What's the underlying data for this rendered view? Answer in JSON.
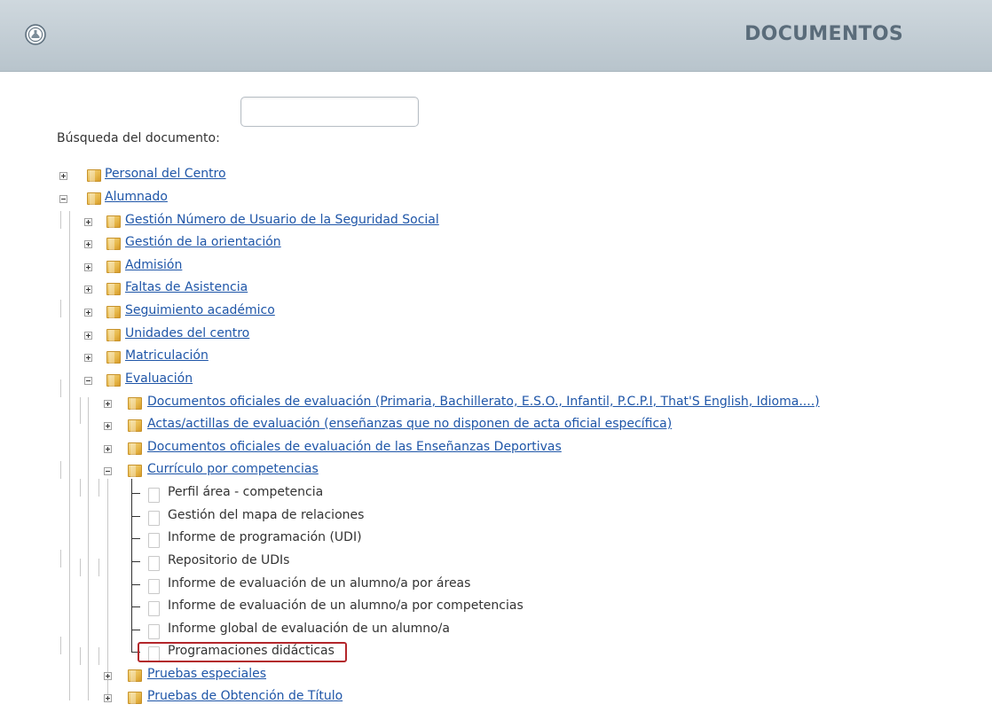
{
  "header": {
    "title": "DOCUMENTOS",
    "logo_icon": "home-logo-icon"
  },
  "search": {
    "label": "Búsqueda del documento:",
    "value": ""
  },
  "tree": {
    "personal": "Personal del Centro",
    "alumnado": "Alumnado",
    "gestion_nuss": "Gestión Número de Usuario de la Seguridad Social",
    "gestion_orientacion": "Gestión de la orientación",
    "admision": "Admisión",
    "faltas": "Faltas de Asistencia",
    "seguimiento": "Seguimiento académico",
    "unidades": "Unidades del centro",
    "matriculacion": "Matriculación",
    "evaluacion": "Evaluación",
    "docs_oficiales": "Documentos oficiales de evaluación (Primaria, Bachillerato, E.S.O., Infantil, P.C.P.I, That'S English, Idioma....)",
    "actas": "Actas/actillas de evaluación (enseñanzas que no disponen de acta oficial específica)",
    "docs_deportivas": "Documentos oficiales de evaluación de las Enseñanzas Deportivas",
    "curriculo": "Currículo por competencias",
    "perfil": "Perfil área - competencia",
    "gestion_mapa": "Gestión del mapa de relaciones",
    "informe_prog": "Informe de programación (UDI)",
    "repositorio": "Repositorio de UDIs",
    "inf_areas": "Informe de evaluación de un alumno/a por áreas",
    "inf_competencias": "Informe de evaluación de un alumno/a por competencias",
    "inf_global": "Informe global de evaluación de un alumno/a",
    "programaciones": "Programaciones didácticas",
    "pruebas_especiales": "Pruebas especiales",
    "pruebas_obtencion": "Pruebas de Obtención de Título"
  },
  "colors": {
    "header_bg": "#c3ced5",
    "link": "#1f56a8",
    "highlight": "#b3262b"
  }
}
